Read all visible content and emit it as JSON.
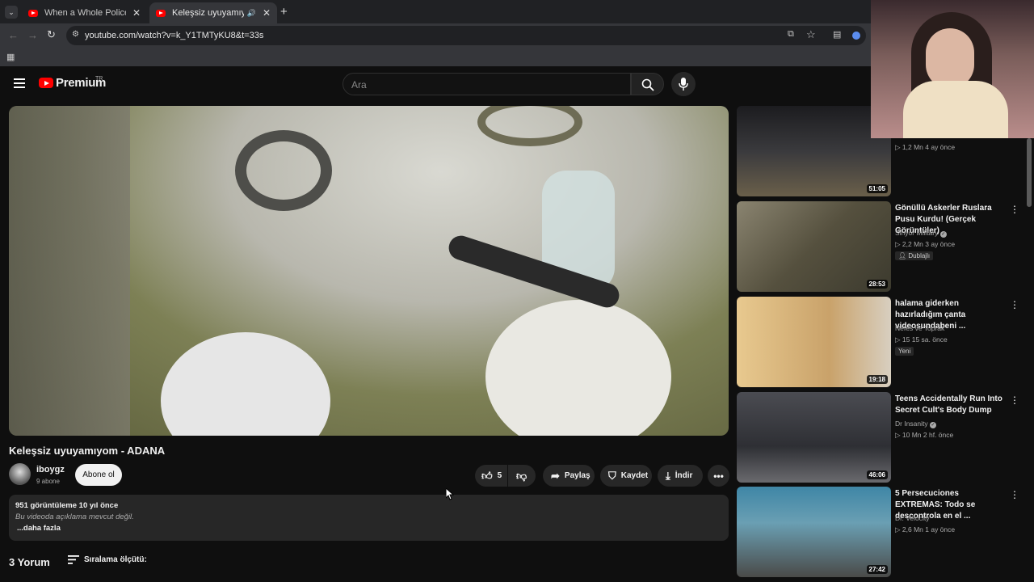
{
  "browser": {
    "tabs": [
      {
        "title": "When a Whole Police Station G..."
      },
      {
        "title": "Keleşsiz uyuyamıyom - ADA..."
      }
    ],
    "url": "youtube.com/watch?v=k_Y1TMTyKU8&t=33s"
  },
  "header": {
    "logo_text": "Premium",
    "logo_region": "TR",
    "search_placeholder": "Ara"
  },
  "video": {
    "title": "Keleşsiz uyuyamıyom - ADANA",
    "channel": "iboygz",
    "subscribers": "9 abone",
    "subscribe_label": "Abone ol",
    "likes": "5",
    "share_label": "Paylaş",
    "save_label": "Kaydet",
    "download_label": "İndir",
    "stats": "951 görüntüleme  10 yıl önce",
    "description": "Bu videoda açıklama mevcut değil.",
    "more_label": "...daha fazla",
    "comments": "3 Yorum",
    "sort_label": "Sıralama ölçütü:"
  },
  "recommendations": [
    {
      "title": "",
      "channel": "",
      "meta": "1,2 Mn  4 ay önce",
      "duration": "51:05",
      "badge": "",
      "thumb_color": "#2b2b2e"
    },
    {
      "title": "Gönüllü Askerler Ruslara Pusu Kurdu! (Gerçek Görüntüler)",
      "channel": "Sinyor Military",
      "meta": "2,2 Mn  3 ay önce",
      "duration": "28:53",
      "badge": "Dublajlı",
      "thumb_color": "#6b6550"
    },
    {
      "title": " halama giderken hazırladığım çanta videosundabeni ...",
      "channel": "Nefes ve Toprak",
      "meta": "15  15 sa. önce",
      "duration": "19:18",
      "badge": "Yeni",
      "thumb_color": "#d9b98c"
    },
    {
      "title": "Teens Accidentally Run Into Secret Cult's Body Dump",
      "channel": "Dr Insanity",
      "meta": "10 Mn  2 hf. önce",
      "duration": "46:06",
      "badge": "",
      "thumb_color": "#3b3c42"
    },
    {
      "title": "5 Persecuciones EXTREMAS: Todo se descontrola en el ...",
      "channel": "Dr. Velocity",
      "meta": "2,6 Mn  1 ay önce",
      "duration": "27:42",
      "badge": "",
      "thumb_color": "#4b7e96"
    }
  ]
}
